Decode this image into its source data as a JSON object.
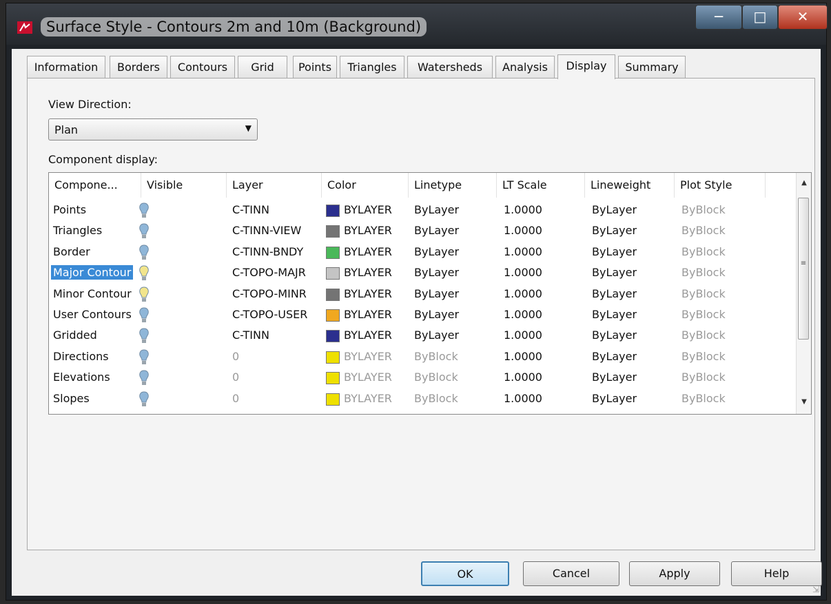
{
  "window": {
    "title": "Surface Style - Contours 2m and 10m (Background)"
  },
  "tabs": [
    {
      "label": "Information",
      "active": false
    },
    {
      "label": "Borders",
      "active": false
    },
    {
      "label": "Contours",
      "active": false
    },
    {
      "label": "Grid",
      "active": false
    },
    {
      "label": "Points",
      "active": false
    },
    {
      "label": "Triangles",
      "active": false
    },
    {
      "label": "Watersheds",
      "active": false
    },
    {
      "label": "Analysis",
      "active": false
    },
    {
      "label": "Display",
      "active": true
    },
    {
      "label": "Summary",
      "active": false
    }
  ],
  "display": {
    "view_direction_label": "View Direction:",
    "view_direction_value": "Plan",
    "component_display_label": "Component display:"
  },
  "grid": {
    "columns": [
      "Compone...",
      "Visible",
      "Layer",
      "Color",
      "Linetype",
      "LT Scale",
      "Lineweight",
      "Plot Style"
    ],
    "rows": [
      {
        "component": "Points",
        "bulb": "blue",
        "layer": "C-TINN",
        "color_hex": "#2b2f8e",
        "color": "BYLAYER",
        "linetype": "ByLayer",
        "lt_scale": "1.0000",
        "lineweight": "ByLayer",
        "plot_style": "ByBlock",
        "dim": false,
        "selected": false
      },
      {
        "component": "Triangles",
        "bulb": "blue",
        "layer": "C-TINN-VIEW",
        "color_hex": "#747474",
        "color": "BYLAYER",
        "linetype": "ByLayer",
        "lt_scale": "1.0000",
        "lineweight": "ByLayer",
        "plot_style": "ByBlock",
        "dim": false,
        "selected": false
      },
      {
        "component": "Border",
        "bulb": "blue",
        "layer": "C-TINN-BNDY",
        "color_hex": "#4ab85a",
        "color": "BYLAYER",
        "linetype": "ByLayer",
        "lt_scale": "1.0000",
        "lineweight": "ByLayer",
        "plot_style": "ByBlock",
        "dim": false,
        "selected": false
      },
      {
        "component": "Major Contour",
        "bulb": "yellow",
        "layer": "C-TOPO-MAJR",
        "color_hex": "#c4c4c4",
        "color": "BYLAYER",
        "linetype": "ByLayer",
        "lt_scale": "1.0000",
        "lineweight": "ByLayer",
        "plot_style": "ByBlock",
        "dim": false,
        "selected": true
      },
      {
        "component": "Minor Contour",
        "bulb": "yellow",
        "layer": "C-TOPO-MINR",
        "color_hex": "#747474",
        "color": "BYLAYER",
        "linetype": "ByLayer",
        "lt_scale": "1.0000",
        "lineweight": "ByLayer",
        "plot_style": "ByBlock",
        "dim": false,
        "selected": false
      },
      {
        "component": "User Contours",
        "bulb": "blue",
        "layer": "C-TOPO-USER",
        "color_hex": "#f0a820",
        "color": "BYLAYER",
        "linetype": "ByLayer",
        "lt_scale": "1.0000",
        "lineweight": "ByLayer",
        "plot_style": "ByBlock",
        "dim": false,
        "selected": false
      },
      {
        "component": "Gridded",
        "bulb": "blue",
        "layer": "C-TINN",
        "color_hex": "#2b2f8e",
        "color": "BYLAYER",
        "linetype": "ByLayer",
        "lt_scale": "1.0000",
        "lineweight": "ByLayer",
        "plot_style": "ByBlock",
        "dim": false,
        "selected": false
      },
      {
        "component": "Directions",
        "bulb": "blue",
        "layer": "0",
        "color_hex": "#eee000",
        "color": "BYLAYER",
        "linetype": "ByBlock",
        "lt_scale": "1.0000",
        "lineweight": "ByLayer",
        "plot_style": "ByBlock",
        "dim": true,
        "selected": false
      },
      {
        "component": "Elevations",
        "bulb": "blue",
        "layer": "0",
        "color_hex": "#eee000",
        "color": "BYLAYER",
        "linetype": "ByBlock",
        "lt_scale": "1.0000",
        "lineweight": "ByLayer",
        "plot_style": "ByBlock",
        "dim": true,
        "selected": false
      },
      {
        "component": "Slopes",
        "bulb": "blue",
        "layer": "0",
        "color_hex": "#eee000",
        "color": "BYLAYER",
        "linetype": "ByBlock",
        "lt_scale": "1.0000",
        "lineweight": "ByLayer",
        "plot_style": "ByBlock",
        "dim": true,
        "selected": false
      }
    ]
  },
  "buttons": {
    "ok": "OK",
    "cancel": "Cancel",
    "apply": "Apply",
    "help": "Help"
  },
  "colors": {
    "selection": "#3a8ad6",
    "bulb_blue": "#8fb6d8",
    "bulb_yellow": "#f2e58c"
  }
}
